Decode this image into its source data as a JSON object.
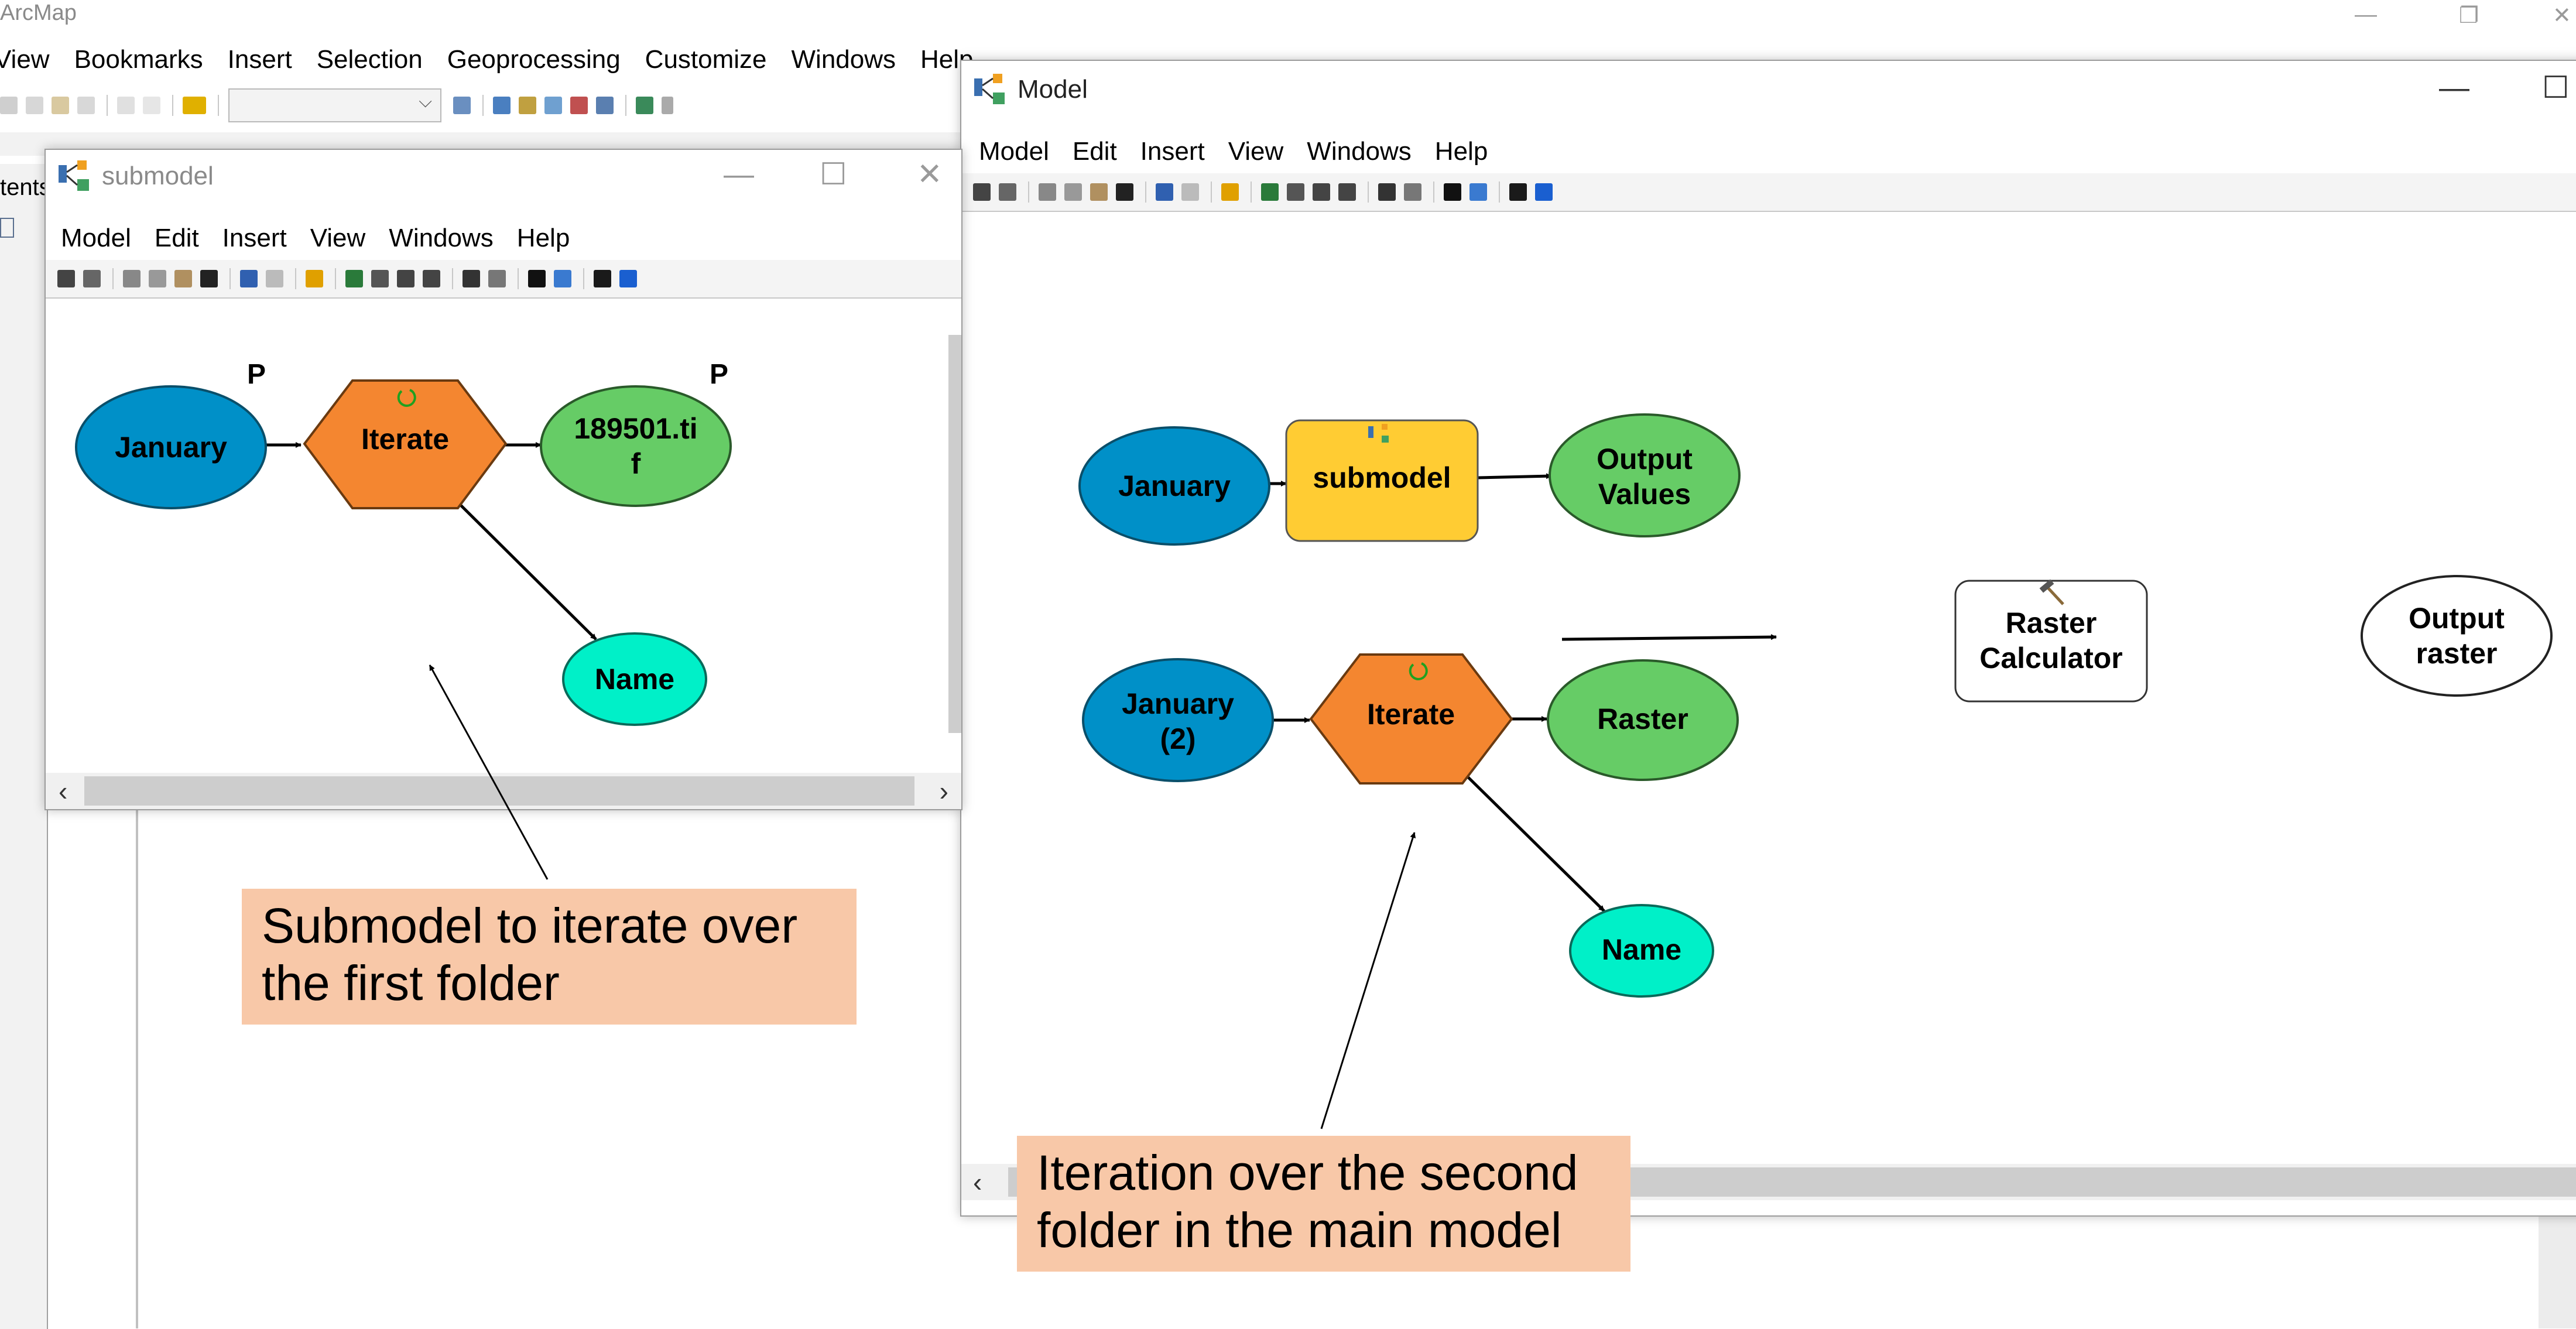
{
  "app": {
    "title": "ArcMap",
    "menu": [
      "View",
      "Bookmarks",
      "Insert",
      "Selection",
      "Geoprocessing",
      "Customize",
      "Windows",
      "Help"
    ],
    "side_label": "tents"
  },
  "submodel_window": {
    "title": "submodel",
    "menu": [
      "Model",
      "Edit",
      "Insert",
      "View",
      "Windows",
      "Help"
    ],
    "nodes": {
      "january": "January",
      "iterate": "Iterate",
      "output_line1": "189501.ti",
      "output_line2": "f",
      "name": "Name"
    },
    "p_marker": "P"
  },
  "model_window": {
    "title": "Model",
    "menu": [
      "Model",
      "Edit",
      "Insert",
      "View",
      "Windows",
      "Help"
    ],
    "nodes": {
      "january": "January",
      "submodel": "submodel",
      "output_values_line1": "Output",
      "output_values_line2": "Values",
      "january2_line1": "January",
      "january2_line2": "(2)",
      "iterate": "Iterate",
      "raster": "Raster",
      "name": "Name",
      "raster_calc_line1": "Raster",
      "raster_calc_line2": "Calculator",
      "output_raster_line1": "Output",
      "output_raster_line2": "raster"
    }
  },
  "callouts": {
    "submodel_line1": "Submodel to iterate over",
    "submodel_line2": "the first folder",
    "main_line1": "Iteration over the second",
    "main_line2": "folder in the main model"
  },
  "colors": {
    "input_blue": "#0090c8",
    "tool_orange": "#f48630",
    "output_green": "#66cc66",
    "name_cyan": "#00f0c8",
    "submodel_yellow": "#ffcc33",
    "callout_peach": "#f8c8a8"
  }
}
